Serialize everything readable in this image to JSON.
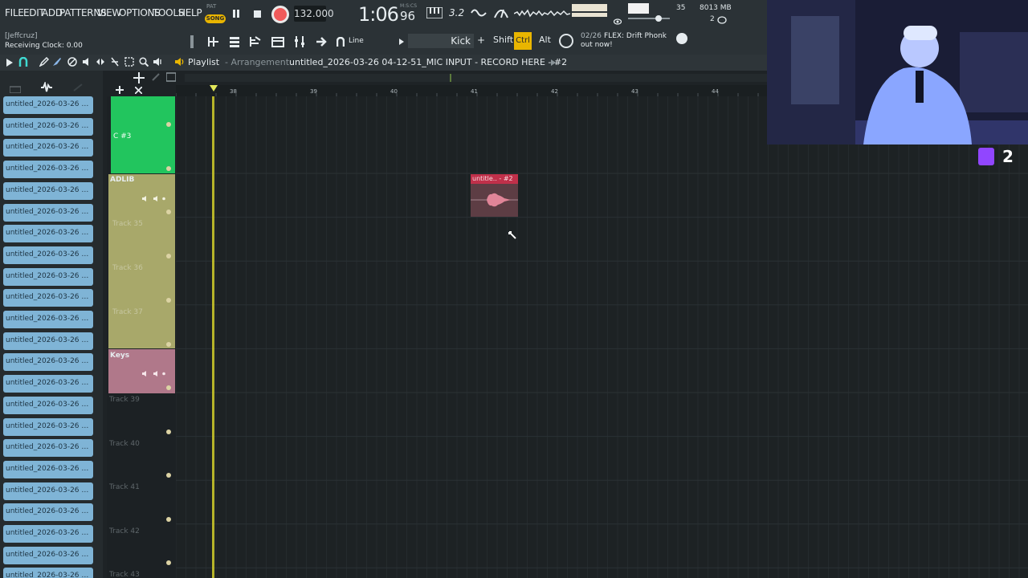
{
  "menu": [
    "FILE",
    "EDIT",
    "ADD",
    "PATTERNS",
    "VIEW",
    "OPTIONS",
    "TOOLS",
    "HELP"
  ],
  "transport": {
    "pat_label": "PAT",
    "song_label": "SONG",
    "tempo": "132.000",
    "time": "1:06",
    "time_sub": "M:S:CS",
    "time_ms": "96",
    "snap_value": "3.2",
    "cpu": "35",
    "memory": "8013 MB",
    "polyphony": "2"
  },
  "toolbar": {
    "user": "[Jeffcruz]",
    "clock_status": "Receiving Clock: 0.00",
    "snap_mode": "Line",
    "pattern": "Kick",
    "pattern_plus": "+",
    "key_shift": "Shift",
    "key_ctrl": "Ctrl",
    "key_alt": "Alt",
    "news_count": "02/26",
    "news_text": "FLEX: Drift Phonk",
    "news_text2": "out now!"
  },
  "playlist": {
    "label": "Playlist",
    "sub": "- Arrangement",
    "title": "untitled_2026-03-26 04-12-51_MIC INPUT - RECORD HERE - #2",
    "bars": [
      "38",
      "39",
      "40",
      "41",
      "42",
      "43",
      "44"
    ]
  },
  "browser": {
    "clip_label": "untitled_2026-03-26 04-..."
  },
  "tracks": [
    {
      "name": "C #3",
      "kind": "green"
    },
    {
      "name": "ADLIB",
      "kind": "olive-header"
    },
    {
      "name": "Track 35",
      "kind": "olive"
    },
    {
      "name": "Track 36",
      "kind": "olive"
    },
    {
      "name": "Track 37",
      "kind": "olive"
    },
    {
      "name": "Keys",
      "kind": "pink-header"
    },
    {
      "name": "Track 39",
      "kind": "empty"
    },
    {
      "name": "Track 40",
      "kind": "empty"
    },
    {
      "name": "Track 41",
      "kind": "empty"
    },
    {
      "name": "Track 42",
      "kind": "empty"
    },
    {
      "name": "Track 43",
      "kind": "empty"
    }
  ],
  "clip": {
    "label": "untitle.. - #2"
  },
  "stream": {
    "viewer_count": "2"
  },
  "colors": {
    "accent_yellow": "#e9b500",
    "track_green": "#22c55e",
    "track_olive": "#a8a86a",
    "track_pink": "#b0788a",
    "clip_red": "#c0304a",
    "browser_clip": "#7fb4d6",
    "twitch_purple": "#9146ff"
  }
}
